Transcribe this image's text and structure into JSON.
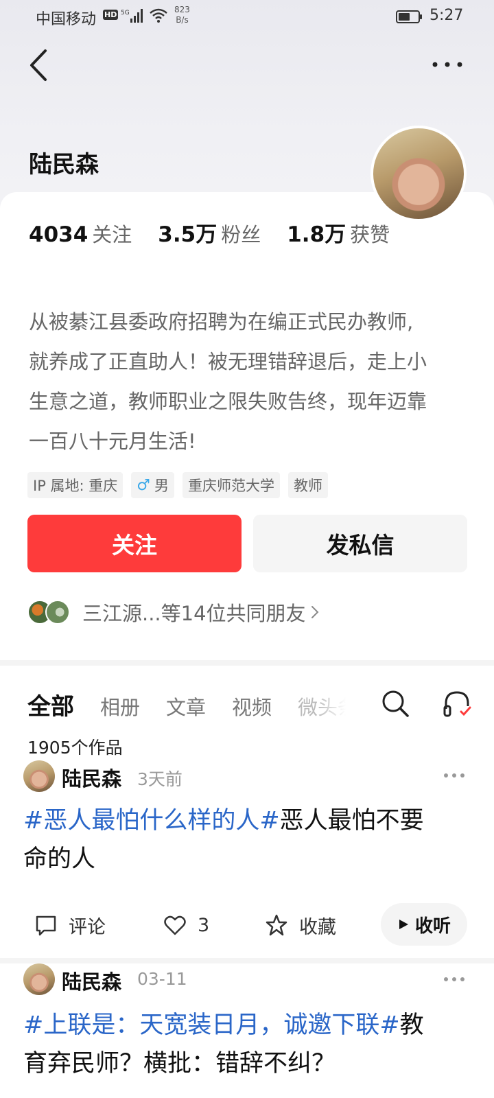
{
  "status_bar": {
    "carrier": "中国移动",
    "hd": "HD",
    "net_speed_value": "823",
    "net_speed_unit": "B/s",
    "time": "5:27"
  },
  "profile": {
    "name": "陆民森",
    "stats": [
      {
        "value": "4034",
        "label": "关注"
      },
      {
        "value": "3.5万",
        "label": "粉丝"
      },
      {
        "value": "1.8万",
        "label": "获赞"
      }
    ],
    "bio_lines": [
      "从被綦江县委政府招聘为在编正式民办教师,",
      "就养成了正直助人！被无理错辞退后，走上小",
      "生意之道，教师职业之限失败告终，现年迈靠",
      "一百八十元月生活!"
    ],
    "tags": {
      "ip": "IP 属地: 重庆",
      "gender_symbol": "♂",
      "gender": "男",
      "school": "重庆师范大学",
      "job": "教师"
    },
    "follow_label": "关注",
    "message_label": "发私信",
    "mutual_friends": "三江源...等14位共同朋友"
  },
  "tabs": {
    "items": [
      "全部",
      "相册",
      "文章",
      "视频",
      "微头条"
    ],
    "active_index": 0
  },
  "works_count": "1905个作品",
  "posts": [
    {
      "author": "陆民森",
      "time": "3天前",
      "hashtag": "#恶人最怕什么样的人#",
      "text_line1": "恶人最怕不要",
      "text_line2": "命的人",
      "actions": {
        "comment": "评论",
        "like_count": "3",
        "favorite": "收藏",
        "listen": "收听"
      }
    },
    {
      "author": "陆民森",
      "time": "03-11",
      "hashtag": "#上联是：天宽装日月，诚邀下联#",
      "text_line1": "教",
      "text_line2": "育弃民师？横批：错辞不纠？"
    }
  ],
  "colors": {
    "accent_red": "#fe3b3b",
    "hashtag_blue": "#2a66c8"
  }
}
